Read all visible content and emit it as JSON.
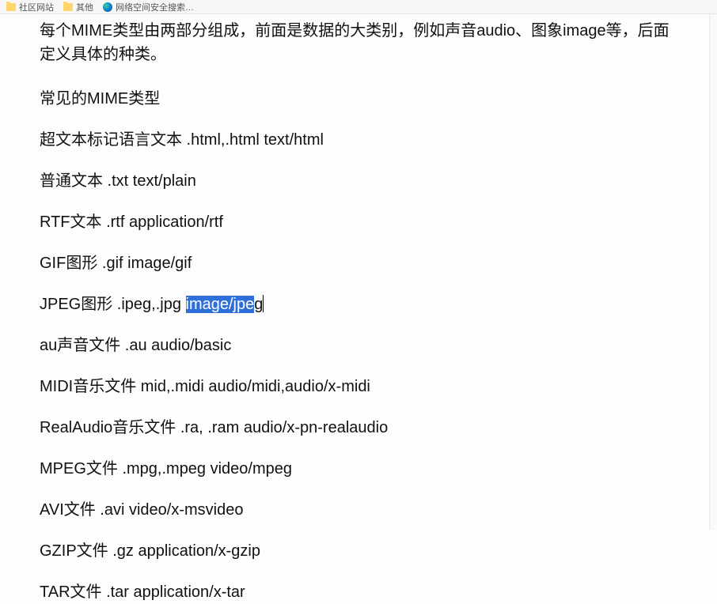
{
  "bookmarks": [
    {
      "kind": "folder",
      "label": "社区网站"
    },
    {
      "kind": "folder",
      "label": "其他"
    },
    {
      "kind": "edge",
      "label": "网络空间安全搜索…"
    }
  ],
  "intro": "每个MIME类型由两部分组成，前面是数据的大类别，例如声音audio、图象image等，后面定义具体的种类。",
  "heading": "常见的MIME类型",
  "mime_list": [
    {
      "pre": "超文本标记语言文本 .html,.html text/html",
      "sel": "",
      "post": ""
    },
    {
      "pre": "普通文本 .txt text/plain",
      "sel": "",
      "post": ""
    },
    {
      "pre": "RTF文本 .rtf application/rtf",
      "sel": "",
      "post": ""
    },
    {
      "pre": "GIF图形 .gif image/gif",
      "sel": "",
      "post": ""
    },
    {
      "pre": "JPEG图形 .ipeg,.jpg ",
      "sel": "image/jpe",
      "post": "g",
      "cursor": true
    },
    {
      "pre": "au声音文件 .au audio/basic",
      "sel": "",
      "post": ""
    },
    {
      "pre": "MIDI音乐文件 mid,.midi audio/midi,audio/x-midi",
      "sel": "",
      "post": ""
    },
    {
      "pre": "RealAudio音乐文件 .ra, .ram audio/x-pn-realaudio",
      "sel": "",
      "post": ""
    },
    {
      "pre": "MPEG文件 .mpg,.mpeg video/mpeg",
      "sel": "",
      "post": ""
    },
    {
      "pre": "AVI文件 .avi video/x-msvideo",
      "sel": "",
      "post": ""
    },
    {
      "pre": "GZIP文件 .gz application/x-gzip",
      "sel": "",
      "post": ""
    },
    {
      "pre": "TAR文件 .tar application/x-tar",
      "sel": "",
      "post": ""
    }
  ]
}
